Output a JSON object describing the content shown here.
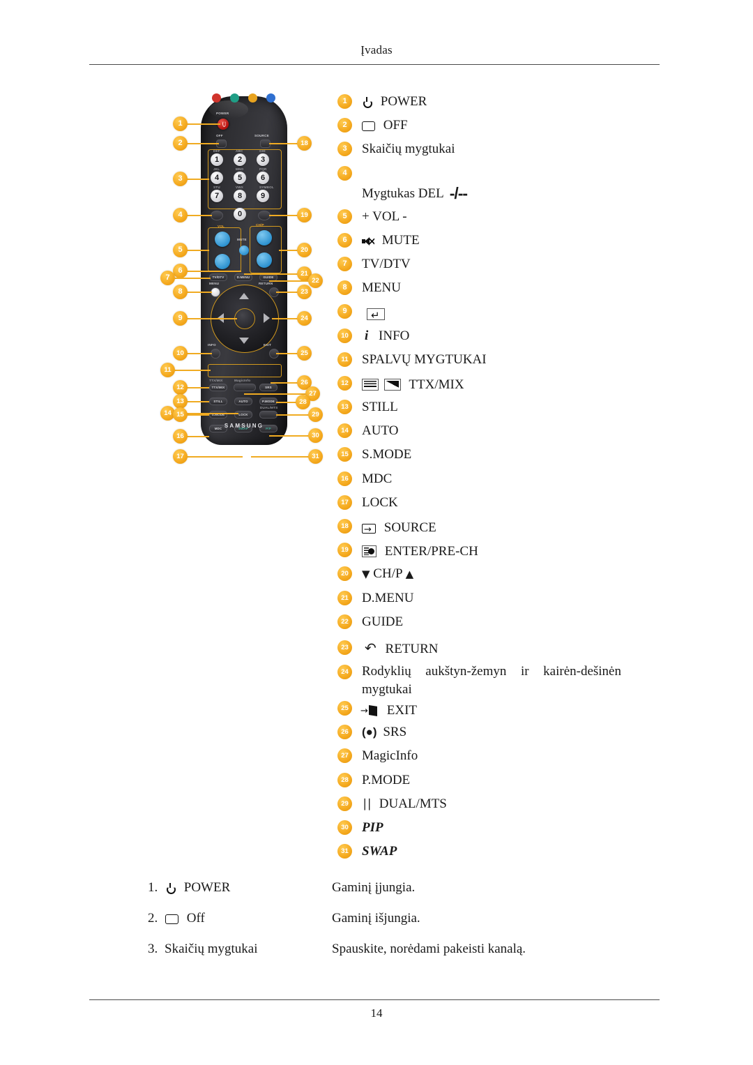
{
  "header": {
    "title": "Įvadas"
  },
  "footer": {
    "page_number": "14"
  },
  "remote": {
    "brand": "SAMSUNG",
    "labels": {
      "power": "POWER",
      "off": "OFF",
      "source": "SOURCE",
      "vol": "VOL",
      "mute": "MUTE",
      "chp": "CH/P",
      "menu": "MENU",
      "return": "RETURN",
      "info": "INFO",
      "exit": "EXIT",
      "magicinfo": "MagicInfo",
      "ttx": "TTX/MIX",
      "srs": "SRS",
      "still": "STILL",
      "auto": "AUTO",
      "pmode": "P.MODE",
      "smode": "S.MODE",
      "lock": "LOCK",
      "dualmts": "DUAL/MTS",
      "mdc": "MDC",
      "swap": "SWAP",
      "pip": "P/P",
      "tvdtv": "TV/DTV",
      "dmenu": "D.MENU",
      "guide": "GUIDE"
    },
    "numbers": [
      "1",
      "2",
      "3",
      "4",
      "5",
      "6",
      "7",
      "8",
      "9",
      "0"
    ],
    "keypad_letters": [
      "DEF",
      "ABC",
      "GHI",
      "JKL",
      "MNO",
      "PQR",
      "STU",
      "VWX",
      "SYMBOL"
    ],
    "callouts_left": [
      "1",
      "2",
      "3",
      "4",
      "5",
      "6",
      "7",
      "8",
      "9",
      "10",
      "11",
      "12",
      "13",
      "14",
      "15",
      "16",
      "17"
    ],
    "callouts_right": [
      "18",
      "19",
      "20",
      "21",
      "22",
      "23",
      "24",
      "25",
      "26",
      "27",
      "28",
      "29",
      "30",
      "31"
    ]
  },
  "legend": [
    {
      "n": "1",
      "label": "POWER",
      "icon": "power-icon"
    },
    {
      "n": "2",
      "label": "OFF",
      "icon": "off-icon"
    },
    {
      "n": "3",
      "label": "Skaičių mygtukai",
      "icon": ""
    },
    {
      "n": "4",
      "label": "Mygtukas DEL",
      "icon": "del-icon",
      "glyph": "-/--"
    },
    {
      "n": "5",
      "label": "+ VOL -",
      "icon": ""
    },
    {
      "n": "6",
      "label": "MUTE",
      "icon": "mute-icon"
    },
    {
      "n": "7",
      "label": "TV/DTV",
      "icon": ""
    },
    {
      "n": "8",
      "label": "MENU",
      "icon": ""
    },
    {
      "n": "9",
      "label": "",
      "icon": "enter-box-icon"
    },
    {
      "n": "10",
      "label": "INFO",
      "icon": "info-icon"
    },
    {
      "n": "11",
      "label": "SPALVŲ MYGTUKAI",
      "icon": ""
    },
    {
      "n": "12",
      "label": "TTX/MIX",
      "icon": "teletext-mix-icon"
    },
    {
      "n": "13",
      "label": "STILL",
      "icon": ""
    },
    {
      "n": "14",
      "label": "AUTO",
      "icon": ""
    },
    {
      "n": "15",
      "label": "S.MODE",
      "icon": ""
    },
    {
      "n": "16",
      "label": "MDC",
      "icon": ""
    },
    {
      "n": "17",
      "label": "LOCK",
      "icon": ""
    },
    {
      "n": "18",
      "label": "SOURCE",
      "icon": "source-icon"
    },
    {
      "n": "19",
      "label": "ENTER/PRE-CH",
      "icon": "pre-channel-icon"
    },
    {
      "n": "20",
      "label": "CH/P",
      "icon": "chevron-down-up-icon"
    },
    {
      "n": "21",
      "label": "D.MENU",
      "icon": ""
    },
    {
      "n": "22",
      "label": "GUIDE",
      "icon": ""
    },
    {
      "n": "23",
      "label": "RETURN",
      "icon": "return-arrow-icon"
    },
    {
      "n": "24",
      "label": "Rodyklių aukštyn-žemyn ir kairėn-dešinėn mygtukai",
      "icon": ""
    },
    {
      "n": "25",
      "label": "EXIT",
      "icon": "exit-door-icon"
    },
    {
      "n": "26",
      "label": "SRS",
      "icon": "srs-icon"
    },
    {
      "n": "27",
      "label": "MagicInfo",
      "icon": ""
    },
    {
      "n": "28",
      "label": "P.MODE",
      "icon": ""
    },
    {
      "n": "29",
      "label": "DUAL/MTS",
      "icon": "dual-icon"
    },
    {
      "n": "30",
      "label": "PIP",
      "icon": "",
      "italic": true
    },
    {
      "n": "31",
      "label": "SWAP",
      "icon": "",
      "italic": true
    }
  ],
  "definitions": [
    {
      "num": "1.",
      "term": "POWER",
      "icon": "power-icon",
      "desc": "Gaminį įjungia."
    },
    {
      "num": "2.",
      "term": "Off",
      "icon": "off-icon",
      "desc": "Gaminį išjungia."
    },
    {
      "num": "3.",
      "term": "Skaičių mygtukai",
      "icon": "",
      "desc": "Spauskite, norėdami pakeisti kanalą."
    }
  ],
  "colors": {
    "badge_orange": "#f4a81d",
    "remote_body": "#2b2b30",
    "power_red": "#b3100d",
    "vol_blue": "#2e93d0",
    "color_buttons": [
      "#d0342c",
      "#1f9e86",
      "#e8a31f",
      "#2f6fd0"
    ]
  }
}
